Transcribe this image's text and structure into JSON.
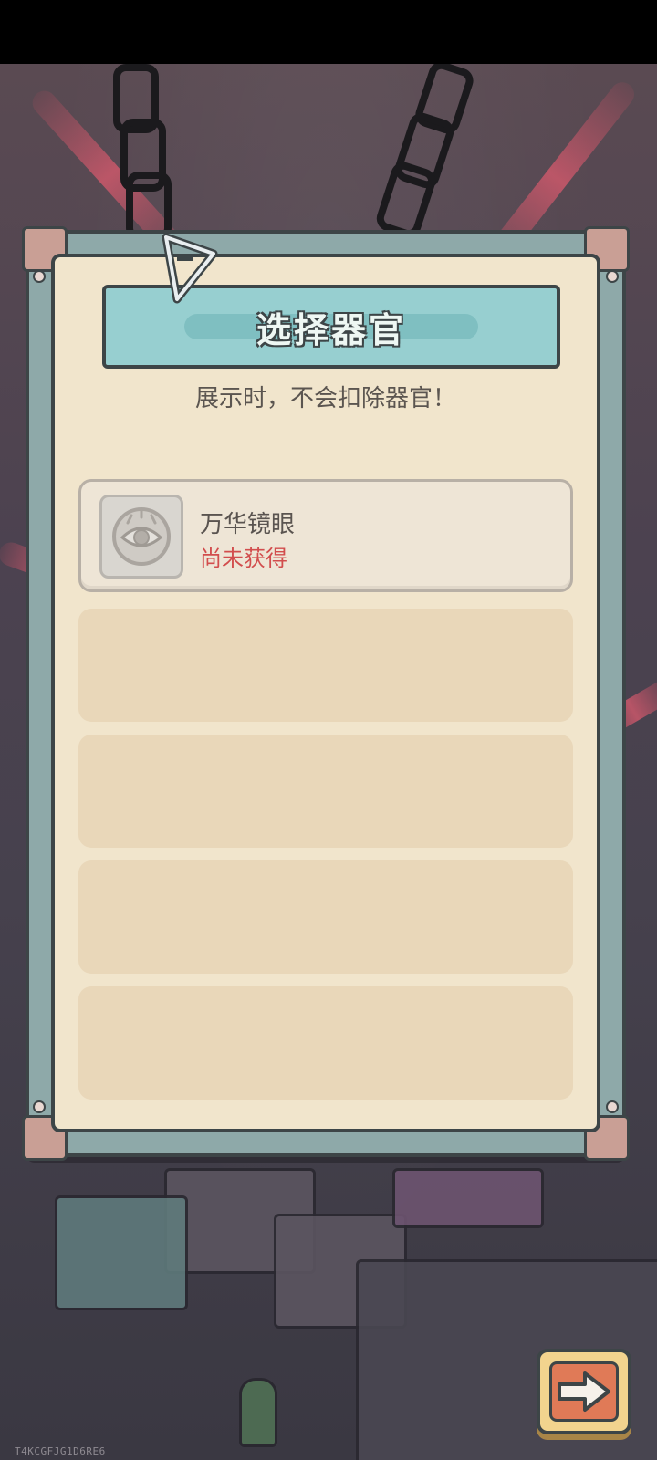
{
  "dialog": {
    "title": "选择器官",
    "subtitle": "展示时，不会扣除器官！"
  },
  "slots": [
    {
      "name": "万华镜眼",
      "status": "尚未获得",
      "icon": "eye-emblem-icon",
      "state": "locked"
    },
    {
      "empty": true
    },
    {
      "empty": true
    },
    {
      "empty": true
    },
    {
      "empty": true
    }
  ],
  "next_button": {
    "icon": "arrow-right-icon"
  },
  "device_id": "T4KCGFJG1D6RE6",
  "colors": {
    "panel_frame": "#8ea9a9",
    "panel_paper": "#f1e5cc",
    "title_banner": "#97cfd0",
    "status_red": "#d24d4d",
    "next_button": "#f2d48e"
  }
}
